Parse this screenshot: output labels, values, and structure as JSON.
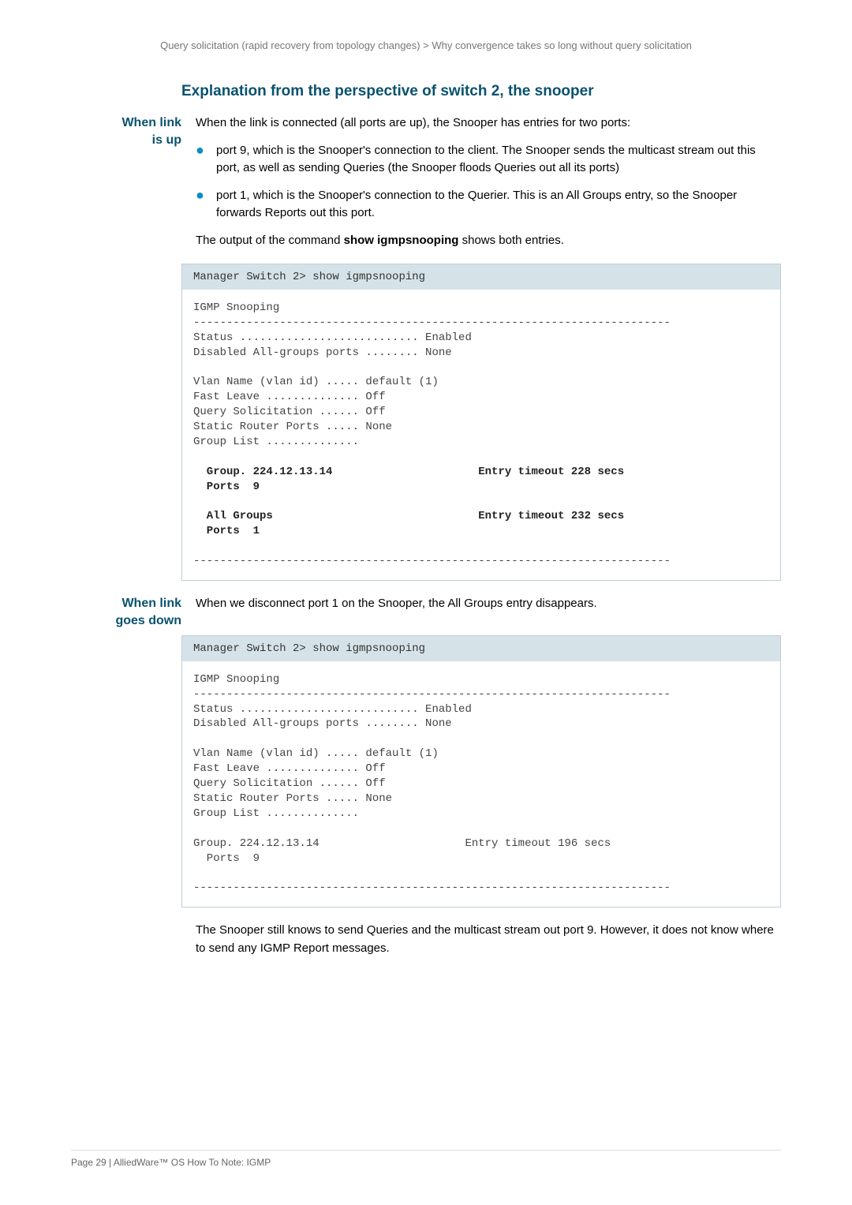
{
  "breadcrumb": {
    "left": "Query solicitation (rapid recovery from topology changes)",
    "sep": "  >  ",
    "right": "Why convergence takes so long without query solicitation"
  },
  "section_title": "Explanation from the perspective of switch 2, the snooper",
  "when_link_up": {
    "label_l1": "When link",
    "label_l2": "is up",
    "intro": "When the link is connected (all ports are up), the Snooper has entries for two ports:",
    "bullet1": "port 9, which is the Snooper's connection to the client. The Snooper sends the multicast stream out this port, as well as sending Queries (the Snooper floods Queries out all its ports)",
    "bullet2": "port 1, which is the Snooper's connection to the Querier. This is an All Groups entry, so the Snooper forwards Reports out this port.",
    "outro_pre": "The output of the command ",
    "outro_cmd": "show igmpsnooping",
    "outro_post": " shows both entries."
  },
  "code1": {
    "header": "Manager Switch 2> show igmpsnooping",
    "l1": "IGMP Snooping",
    "l2": "------------------------------------------------------------------------",
    "l3": "Status ........................... Enabled",
    "l4": "Disabled All-groups ports ........ None",
    "l5": "",
    "l6": "Vlan Name (vlan id) ..... default (1)",
    "l7": "Fast Leave .............. Off",
    "l8": "Query Solicitation ...... Off",
    "l9": "Static Router Ports ..... None",
    "l10": "Group List ..............",
    "l11": "",
    "l12a": "  Group. 224.12.13.14                      Entry timeout 228 secs",
    "l13a": "  Ports  9",
    "l14": "",
    "l15a": "  All Groups                               Entry timeout 232 secs",
    "l16a": "  Ports  1",
    "l17": "",
    "l18": "------------------------------------------------------------------------"
  },
  "when_link_down": {
    "label_l1": "When link",
    "label_l2": "goes down",
    "text": "When we disconnect port 1 on the Snooper, the All Groups entry disappears."
  },
  "code2": {
    "header": "Manager Switch 2> show igmpsnooping",
    "l1": "IGMP Snooping",
    "l2": "------------------------------------------------------------------------",
    "l3": "Status ........................... Enabled",
    "l4": "Disabled All-groups ports ........ None",
    "l5": "",
    "l6": "Vlan Name (vlan id) ..... default (1)",
    "l7": "Fast Leave .............. Off",
    "l8": "Query Solicitation ...... Off",
    "l9": "Static Router Ports ..... None",
    "l10": "Group List ..............",
    "l11": "",
    "l12": "Group. 224.12.13.14                      Entry timeout 196 secs",
    "l13": "  Ports  9",
    "l14": "",
    "l15": "------------------------------------------------------------------------"
  },
  "closing": "The Snooper still knows to send Queries and the multicast stream out port 9. However, it does not know where to send any IGMP Report messages.",
  "footer": "Page 29 | AlliedWare™ OS How To Note: IGMP"
}
